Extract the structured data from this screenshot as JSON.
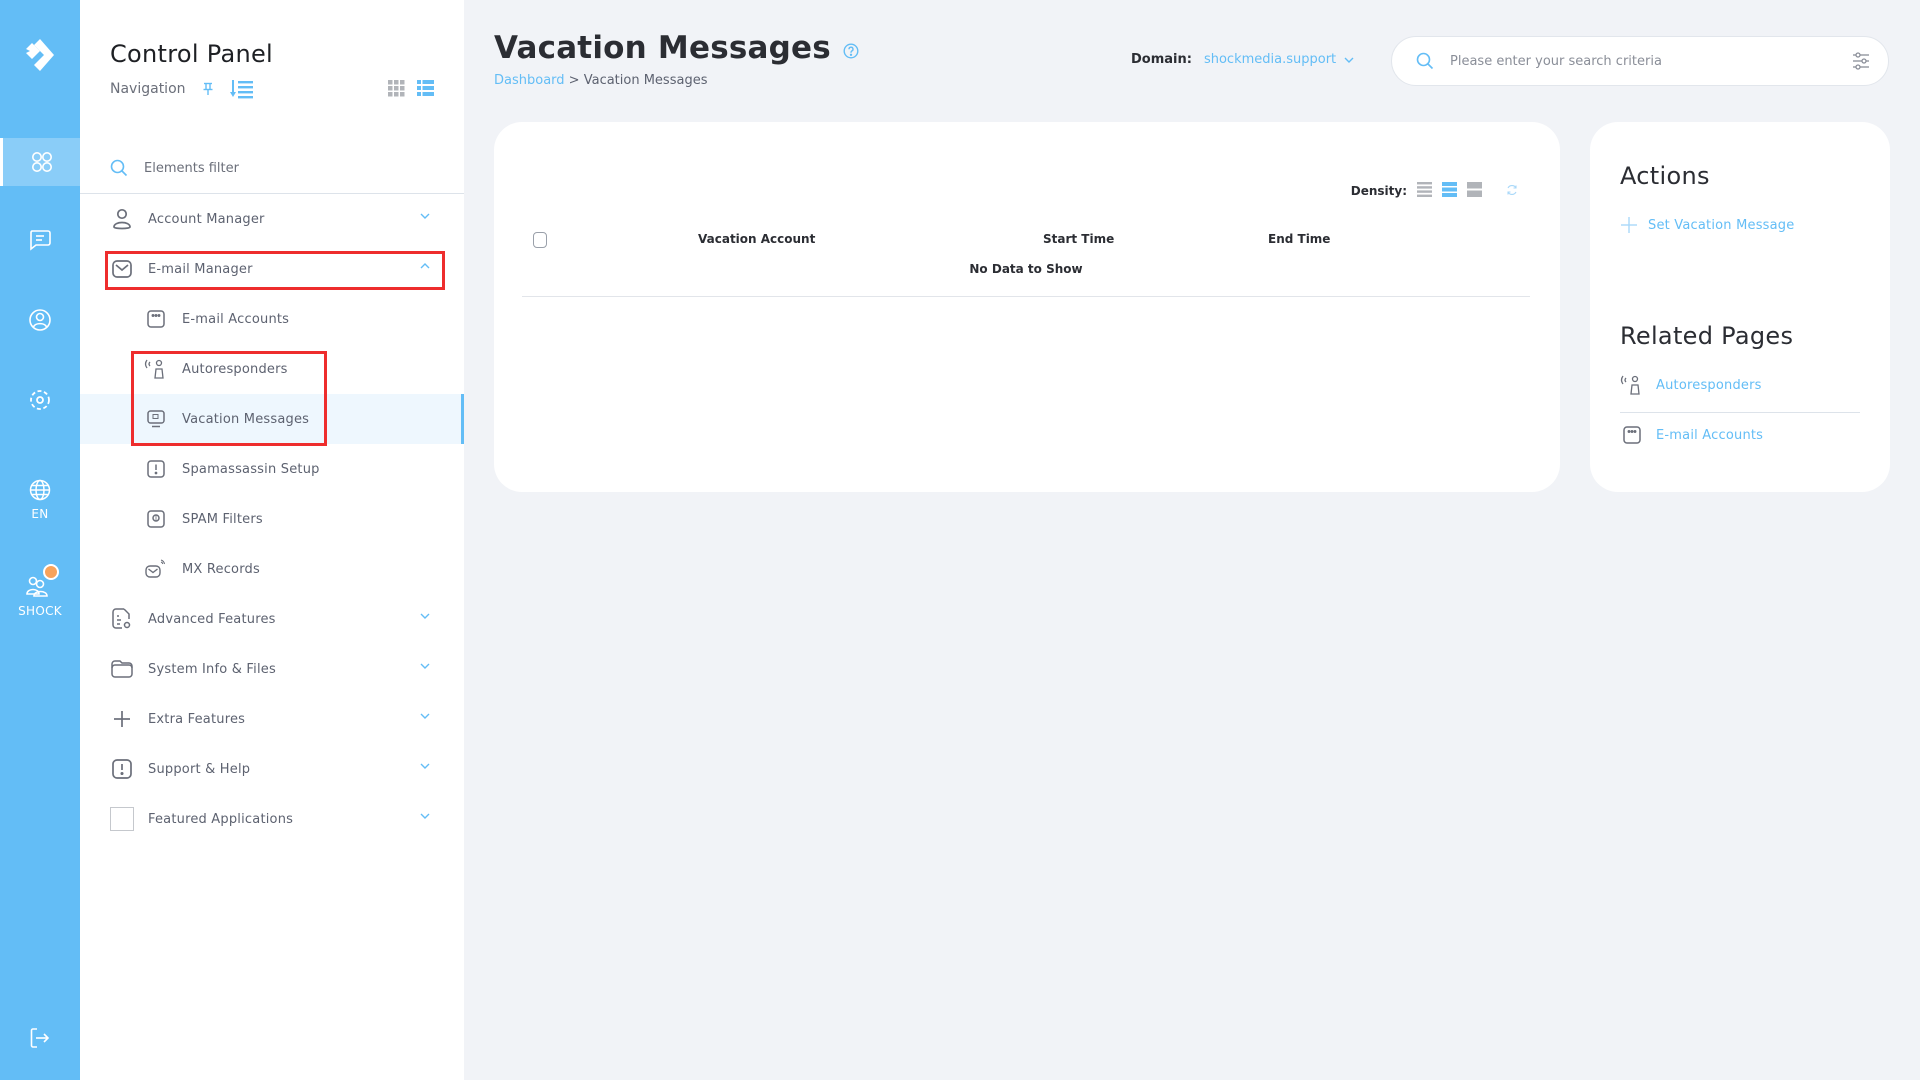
{
  "rail": {
    "items": [
      {
        "name": "dashboard",
        "icon": "dashboard-grid-icon",
        "active": true
      },
      {
        "name": "messages",
        "icon": "message-icon"
      },
      {
        "name": "account",
        "icon": "user-circle-icon"
      },
      {
        "name": "settings",
        "icon": "gear-icon"
      },
      {
        "name": "language",
        "icon": "globe-icon",
        "label": "EN"
      },
      {
        "name": "user",
        "icon": "users-icon",
        "label": "SHOCK",
        "badge_color": "#f7a35c"
      }
    ],
    "logout_icon": "logout-icon",
    "color": "#63bdf6"
  },
  "sidebar": {
    "title": "Control Panel",
    "subtitle": "Navigation",
    "filter_placeholder": "Elements filter",
    "menu": [
      {
        "label": "Account Manager",
        "icon": "user-icon",
        "expandable": true,
        "expanded": false
      },
      {
        "label": "E-mail Manager",
        "icon": "mail-icon",
        "expandable": true,
        "expanded": true
      },
      {
        "label": "E-mail Accounts",
        "icon": "mail-account-icon",
        "sub": true
      },
      {
        "label": "Autoresponders",
        "icon": "autoresponder-icon",
        "sub": true
      },
      {
        "label": "Vacation Messages",
        "icon": "vacation-monitor-icon",
        "sub": true,
        "active": true
      },
      {
        "label": "Spamassassin Setup",
        "icon": "alert-square-icon",
        "sub": true
      },
      {
        "label": "SPAM Filters",
        "icon": "filter-square-icon",
        "sub": true
      },
      {
        "label": "MX Records",
        "icon": "mail-signal-icon",
        "sub": true
      },
      {
        "label": "Advanced Features",
        "icon": "document-gear-icon",
        "expandable": true
      },
      {
        "label": "System Info & Files",
        "icon": "folder-icon",
        "expandable": true
      },
      {
        "label": "Extra Features",
        "icon": "plus-icon",
        "expandable": true
      },
      {
        "label": "Support & Help",
        "icon": "alert-square-icon",
        "expandable": true
      },
      {
        "label": "Featured Applications",
        "icon": "blank-square-icon",
        "expandable": true
      }
    ]
  },
  "header": {
    "title": "Vacation Messages",
    "breadcrumb": [
      {
        "label": "Dashboard",
        "link": true
      },
      {
        "label": "Vacation Messages"
      }
    ],
    "breadcrumb_sep": ">",
    "domain_label": "Domain:",
    "domain_value": "shockmedia.support",
    "search_placeholder": "Please enter your search criteria"
  },
  "table": {
    "density_label": "Density:",
    "density_options": [
      "compact",
      "normal",
      "comfortable"
    ],
    "density_selected": "normal",
    "columns": [
      "Vacation Account",
      "Start Time",
      "End Time"
    ],
    "rows": [],
    "empty_text": "No Data to Show"
  },
  "actions": {
    "title": "Actions",
    "items": [
      {
        "label": "Set Vacation Message",
        "icon": "plus-icon"
      }
    ]
  },
  "related": {
    "title": "Related Pages",
    "items": [
      {
        "label": "Autoresponders",
        "icon": "autoresponder-icon"
      },
      {
        "label": "E-mail Accounts",
        "icon": "mail-account-icon"
      }
    ]
  },
  "colors": {
    "accent": "#63bdf6",
    "highlight_annotation": "#ee2d2d",
    "background": "#f1f3f7",
    "badge": "#f7a35c"
  }
}
